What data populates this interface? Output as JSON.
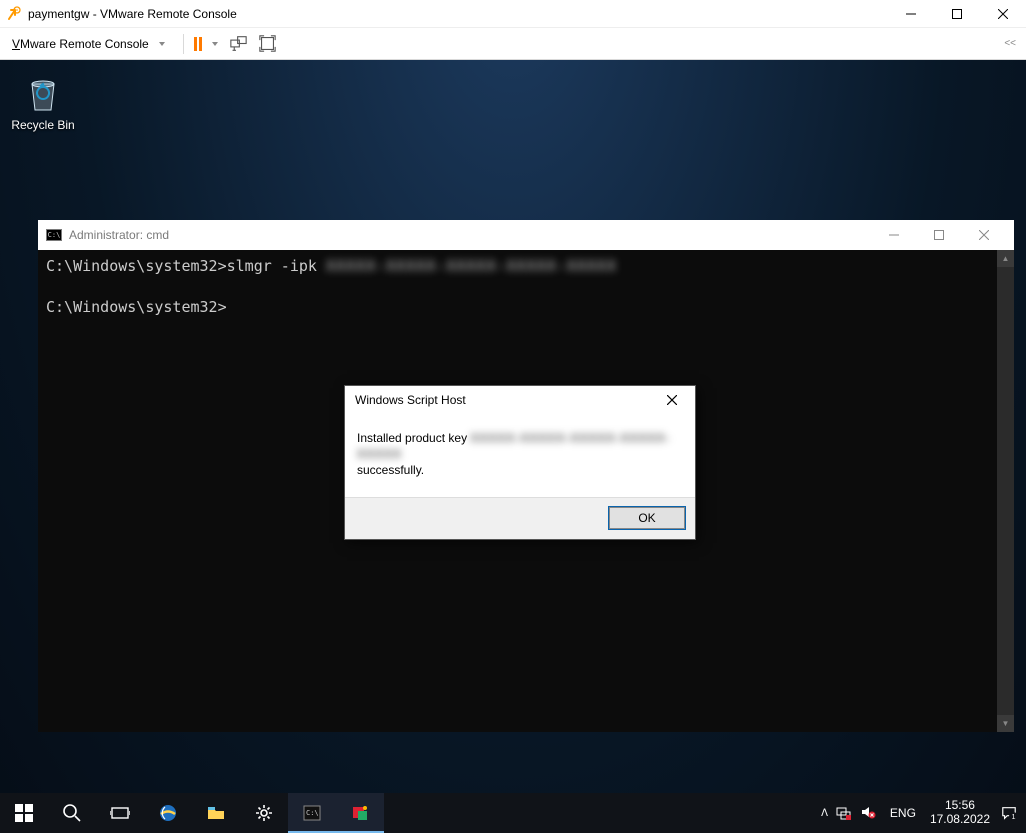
{
  "vmware": {
    "title": "paymentgw - VMware Remote Console",
    "menu_label_prefix": "V",
    "menu_label_rest": "Mware Remote Console"
  },
  "desktop": {
    "recycle_bin_label": "Recycle Bin"
  },
  "cmd": {
    "title": "Administrator: cmd",
    "line1_prompt": "C:\\Windows\\system32>",
    "line1_cmd": "slmgr -ipk ",
    "line1_key_obscured": "XXXXX-XXXXX-XXXXX-XXXXX-XXXXX",
    "line2_prompt": "C:\\Windows\\system32>"
  },
  "dialog": {
    "title": "Windows Script Host",
    "msg_prefix": "Installed product key ",
    "msg_key_obscured": "XXXXX-XXXXX-XXXXX-XXXXX-XXXXX",
    "msg_suffix": " successfully.",
    "ok_label": "OK"
  },
  "tray": {
    "lang": "ENG",
    "time": "15:56",
    "date": "17.08.2022",
    "notif_badge": "1"
  }
}
